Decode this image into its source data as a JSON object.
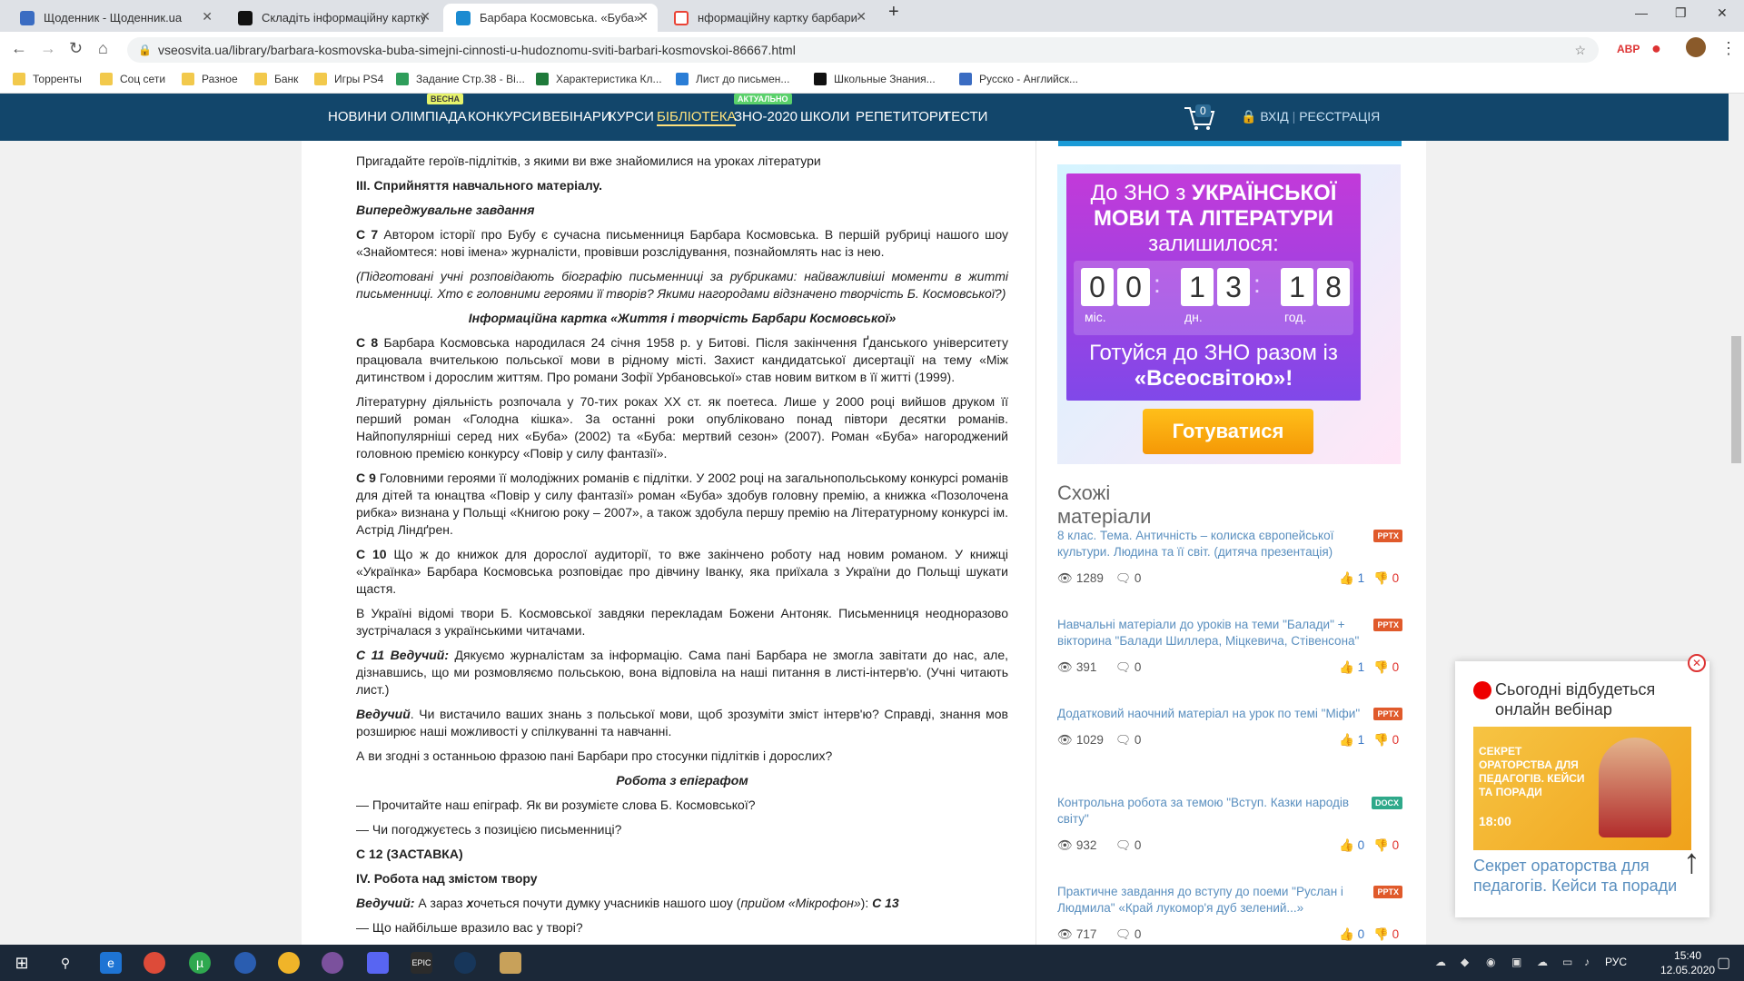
{
  "browser": {
    "tabs": [
      {
        "title": "Щоденник - Щоденник.ua",
        "favicon_color": "#3a6cc2",
        "active": false
      },
      {
        "title": "Складіть інформаційну картку б",
        "favicon_color": "#111111",
        "active": false
      },
      {
        "title": "Барбара Космовська. «Буба». С",
        "favicon_color": "#1b8bd1",
        "active": true
      },
      {
        "title": "нформаційну картку барбари К",
        "favicon_color": "#ea4335",
        "active": false
      }
    ],
    "new_tab": "+",
    "url": "vseosvita.ua/library/barbara-kosmovska-buba-simejni-cinnosti-u-hudoznomu-sviti-barbari-kosmovskoi-86667.html",
    "bookmarks": [
      {
        "label": "Торренты",
        "color": "#f2c94c"
      },
      {
        "label": "Соц сети",
        "color": "#f2c94c"
      },
      {
        "label": "Разное",
        "color": "#f2c94c"
      },
      {
        "label": "Банк",
        "color": "#f2c94c"
      },
      {
        "label": "Игры PS4",
        "color": "#f2c94c"
      },
      {
        "label": "Задание Стр.38 - Ві...",
        "color": "#2f9e5b"
      },
      {
        "label": "Характеристика Кл...",
        "color": "#1f7a3a"
      },
      {
        "label": "Лист до письмен...",
        "color": "#2a7dd6"
      },
      {
        "label": "Школьные Знания...",
        "color": "#111111"
      },
      {
        "label": "Русско - Английск...",
        "color": "#3a6cc2"
      }
    ]
  },
  "site_nav": {
    "items": [
      "НОВИНИ",
      "ОЛІМПІАДА",
      "КОНКУРСИ",
      "ВЕБІНАРИ",
      "КУРСИ",
      "БІБЛІОТЕКА",
      "ЗНО-2020",
      "ШКОЛИ",
      "РЕПЕТИТОРИ",
      "ТЕСТИ"
    ],
    "badge_spring": "ВЕСНА",
    "badge_actual": "АКТУАЛЬНО",
    "cart_count": "0",
    "login": "ВХІД",
    "register": "РЕЄСТРАЦІЯ"
  },
  "article": {
    "p0": "Пригадайте героїв-підлітків, з якими ви вже знайомилися на уроках літератури",
    "h3": "ІІІ. Сприйняття навчального матеріалу.",
    "task": "Випереджувальне завдання",
    "c7_tag": "С 7",
    "c7": "Автором історії про Бубу є сучасна письменниця Барбара Космовська. В першій рубриці нашого шоу «Знайомтеся: нові імена» журналісти, провівши розслідування, познайомлять нас із нею.",
    "note": "(Підготовані учні розповідають біографію письменниці за рубриками: найважливіші моменти в житті письменниці. Хто є головними героями її творів? Якими нагородами відзначено творчість Б. Космовської?)",
    "card_title": "Інформаційна картка «Життя і творчість Барбари Космовської»",
    "c8_tag": "С 8",
    "c8": "Барбара Космовська народилася 24 січня 1958 р. у Битові. Після закінчення Ґданського університету працювала вчителькою польської мови в рідному місті. Захист кандидатської дисертації на тему «Між дитинством і дорослим життям. Про романи Зофії Урбановської» став новим витком в її житті (1999).",
    "p_lit": "Літературну діяльність розпочала у 70-тих роках XX ст. як поетеса. Лише у 2000 році вийшов друком її перший роман «Голодна кішка». За останні роки опубліковано понад півтори десятки романів. Найпопулярніші серед них «Буба» (2002) та «Буба: мертвий сезон» (2007). Роман «Буба» нагороджений головною премією конкурсу «Повір у силу фантазії».",
    "c9_tag": "С 9",
    "c9": "Головними героями її молодіжних романів є підлітки. У 2002 році на загальнопольському конкурсі романів для дітей та юнацтва «Повір у силу фантазії» роман «Буба» здобув головну премію, а книжка «Позолочена рибка» визнана у Польщі «Книгою року – 2007», а також здобула першу премію на Літературному конкурсі ім. Астрід Ліндґрен.",
    "c10_tag": "С 10",
    "c10": "Що ж до книжок для дорослої аудиторії, то вже закінчено роботу над новим романом. У книжці «Українка» Барбара Космовська розповідає про дівчину Іванку, яка приїхала з України до Польщі шукати щастя.",
    "p_ukr": "В Україні відомі твори Б. Космовської завдяки перекладам Божени Антоняк. Письменниця неодноразово зустрічалася з українськими читачами.",
    "c11_tag": "С 11 Ведучий:",
    "c11": "Дякуємо журналістам за інформацію. Сама пані Барбара не змогла завітати до нас, але, дізнавшись, що ми розмовляємо польською, вона відповіла на наші питання в листі-інтерв'ю. (Учні читають лист.)",
    "host_tag": "Ведучий",
    "host": ". Чи вистачило ваших знань з польської мови, щоб зрозуміти зміст інтерв'ю? Справді, знання мов розширює наші можливості у спілкуванні та навчанні.",
    "q1": "А ви згодні з останньою фразою пані Барбари про стосунки підлітків і дорослих?",
    "epigraph": "Робота з епіграфом",
    "q2": "— Прочитайте наш епіграф. Як ви розумієте слова Б. Космовської?",
    "q3": "— Чи погоджуєтесь з позицією письменниці?",
    "c12": "С 12 (ЗАСТАВКА)",
    "h4": "IV. Робота над змістом твору",
    "host2_tag": "Ведучий:",
    "host2_a": "А зараз ",
    "host2_x": "х",
    "host2_b": "очеться почути думку учасників нашого шоу (",
    "host2_i": "прийом «Мікрофон»",
    "host2_c": "): ",
    "host2_tag2": "С 13",
    "q4": "— Що найбільше вразило вас у творі?"
  },
  "zno": {
    "line1": "До ЗНО з",
    "line1b": "УКРАЇНСЬКОЇ",
    "line2": "МОВИ ТА ЛІТЕРАТУРИ",
    "line3": "залишилося:",
    "digits": [
      "0",
      "0",
      "1",
      "3",
      "1",
      "8"
    ],
    "labels": [
      "міс.",
      "дн.",
      "год."
    ],
    "line4": "Готуйся до ЗНО разом із",
    "line5": "«Всеосвітою»!",
    "button": "Готуватися"
  },
  "similar": {
    "title": "Схожі матеріали",
    "items": [
      {
        "text": "8 клас. Тема. Античність – колиска європейської культури. Людина та її світ. (дитяча презентація)",
        "type": "PPTX",
        "type_color": "#e05a2b",
        "views": "1289",
        "comments": "0",
        "likes": "1",
        "dislikes": "0"
      },
      {
        "text": "Навчальні матеріали до уроків на теми \"Балади\" + вікторина \"Балади Шиллера, Міцкевича, Стівенсона\"",
        "type": "PPTX",
        "type_color": "#e05a2b",
        "views": "391",
        "comments": "0",
        "likes": "1",
        "dislikes": "0"
      },
      {
        "text": "Додатковий наочний матеріал на урок по темі \"Міфи\"",
        "type": "PPTX",
        "type_color": "#e05a2b",
        "views": "1029",
        "comments": "0",
        "likes": "1",
        "dislikes": "0"
      },
      {
        "text": "Контрольна робота за темою \"Вступ. Казки народів світу\"",
        "type": "DOCX",
        "type_color": "#2fa98a",
        "views": "932",
        "comments": "0",
        "likes": "0",
        "dislikes": "0"
      },
      {
        "text": "Практичне завдання до вступу до поеми \"Руслан і Людмила\" «Край лукомор'я дуб зелений...»",
        "type": "PPTX",
        "type_color": "#e05a2b",
        "views": "717",
        "comments": "0",
        "likes": "0",
        "dislikes": "0"
      }
    ]
  },
  "popup": {
    "text": "Сьогодні відбудеться онлайн вебінар",
    "image_text": "СЕКРЕТ ОРАТОРСТВА ДЛЯ ПЕДАГОГІВ. КЕЙСИ ТА ПОРАДИ",
    "image_time": "18:00",
    "link": "Секрет ораторства для педагогів. Кейси та поради"
  },
  "taskbar": {
    "lang": "РУС",
    "time": "15:40",
    "date": "12.05.2020"
  }
}
